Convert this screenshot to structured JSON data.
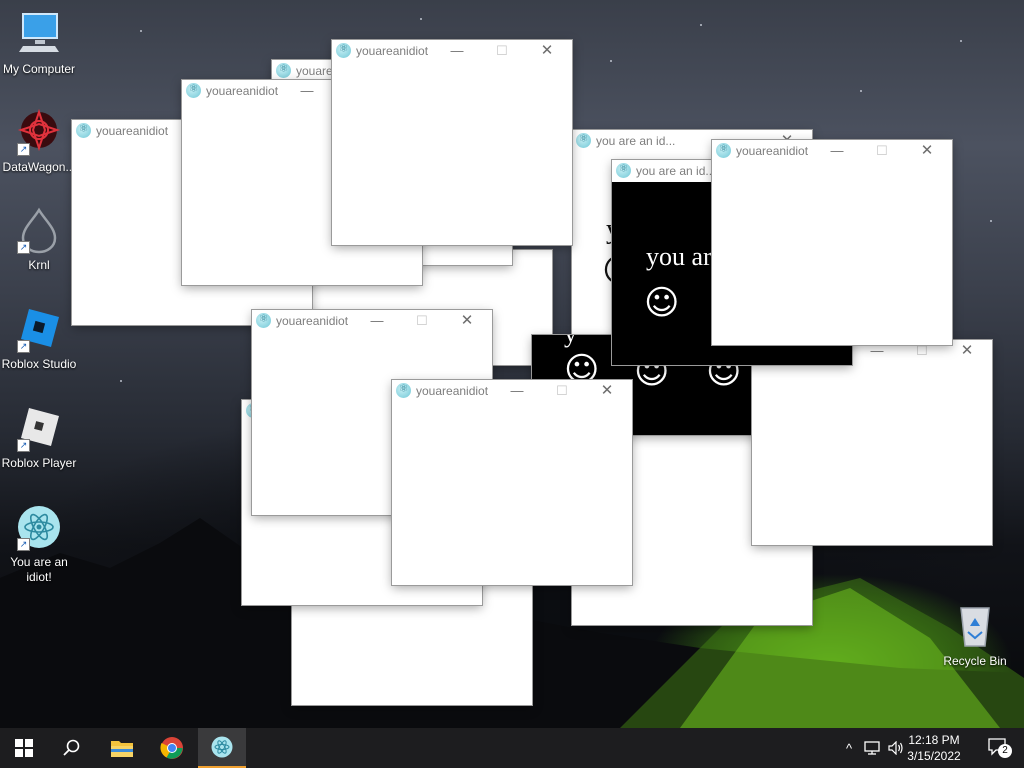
{
  "desktop_icons": [
    {
      "label": "My Computer",
      "icon": "monitor-icon",
      "shortcut": false
    },
    {
      "label": "DataWagon...",
      "icon": "datawagon-logo-icon",
      "shortcut": true
    },
    {
      "label": "Krnl",
      "icon": "krnl-drop-icon",
      "shortcut": true
    },
    {
      "label": "Roblox Studio",
      "icon": "roblox-studio-icon",
      "shortcut": true
    },
    {
      "label": "Roblox Player",
      "icon": "roblox-player-icon",
      "shortcut": true
    },
    {
      "label": "You are an idiot!",
      "icon": "electron-app-icon",
      "shortcut": true
    }
  ],
  "recycle_bin": {
    "label": "Recycle Bin",
    "icon": "recycle-bin-icon"
  },
  "windows": {
    "title_full": "youareanidiot",
    "title_partial": "youare",
    "title_alt": "you are an id...",
    "big_text_1": "you ar",
    "big_text_2": "you are",
    "glyph_y": "y",
    "smiley": "☺",
    "minimize_glyph": "—",
    "maximize_glyph": "☐",
    "close_glyph": "✕"
  },
  "taskbar": {
    "items": [
      "windows-start-icon",
      "search-icon",
      "file-explorer-icon",
      "chrome-icon",
      "electron-app-icon"
    ],
    "active_item": "electron-app-icon",
    "tray": {
      "chevron": "^",
      "network_icon": "network-icon",
      "volume_icon": "volume-icon",
      "time": "12:18 PM",
      "date": "3/15/2022",
      "notification_count": "2"
    }
  },
  "colors": {
    "taskbar_bg": "#1d1d1f",
    "active_underline": "#f0a030",
    "tent_green": "#7fd623"
  }
}
